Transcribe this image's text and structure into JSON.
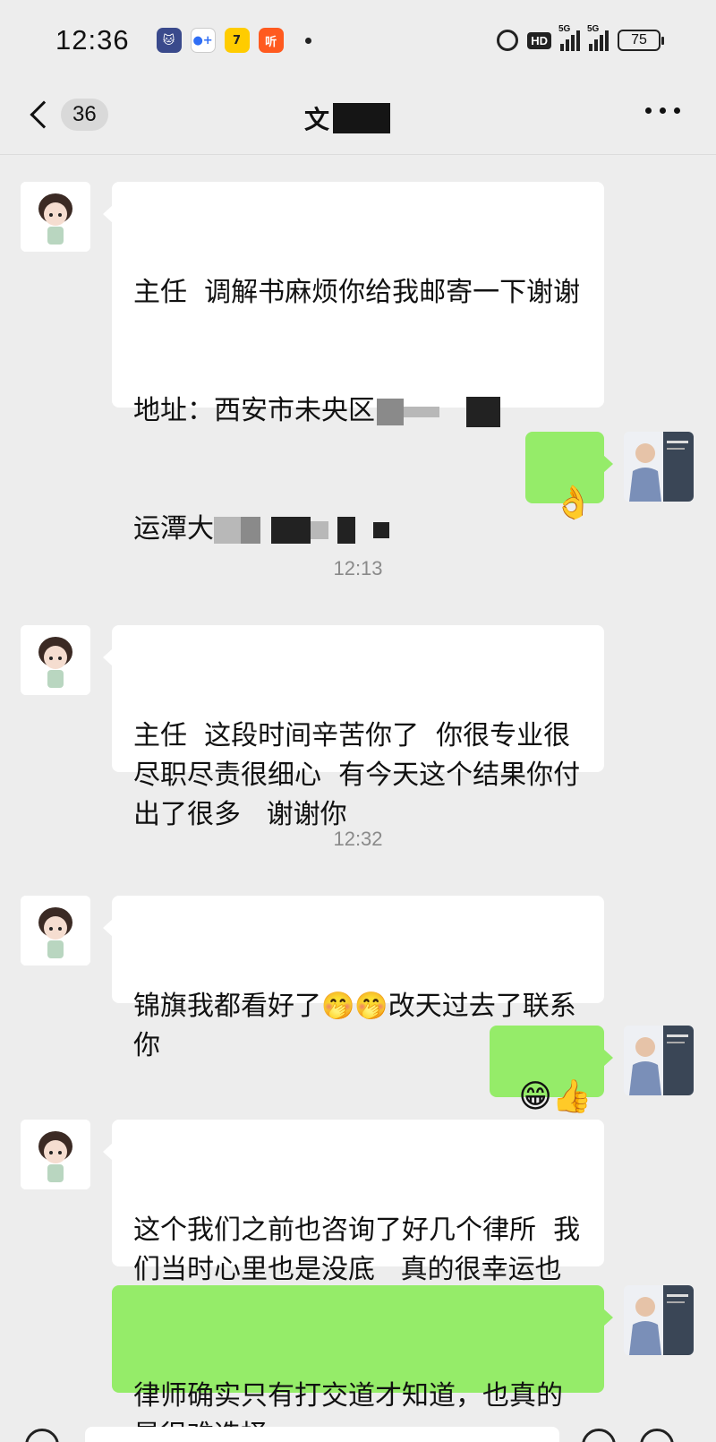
{
  "status_bar": {
    "time": "12:36",
    "app_icons": [
      "cat-app-icon",
      "meeting-app-icon",
      "duck-app-icon",
      "listen-app-icon"
    ],
    "listen_icon_char": "听",
    "hd_label": "HD",
    "signal_label": "5G",
    "battery": "75"
  },
  "nav": {
    "unread_count": "36",
    "title": "文"
  },
  "messages": [
    {
      "sender": "other",
      "text": "主任  调解书麻烦你给我邮寄一下谢谢"
    },
    {
      "sender": "other",
      "address_prefix": "地址：西安市未央区",
      "address_line2_prefix": "运潭大"
    },
    {
      "sender": "me",
      "emoji": "👌"
    },
    {
      "type": "time",
      "text": "12:13"
    },
    {
      "sender": "other",
      "text": "主任  这段时间辛苦你了  你很专业很尽职尽责很细心  有今天这个结果你付出了很多   谢谢你"
    },
    {
      "type": "time",
      "text": "12:32"
    },
    {
      "sender": "other",
      "text_before": "锦旗我都看好了",
      "emoji": "🤭🤭",
      "text_after": "改天过去了联系你"
    },
    {
      "sender": "me",
      "emoji": "😁👍"
    },
    {
      "sender": "other",
      "text": "这个我们之前也咨询了好几个律所  我们当时心里也是没底   真的很幸运也很庆幸最终和你们携手"
    },
    {
      "sender": "me",
      "text": "律师确实只有打交道才知道，也真的是很难选择。"
    }
  ],
  "colors": {
    "background": "#ededed",
    "bubble_in": "#ffffff",
    "bubble_out": "#95ec69"
  }
}
